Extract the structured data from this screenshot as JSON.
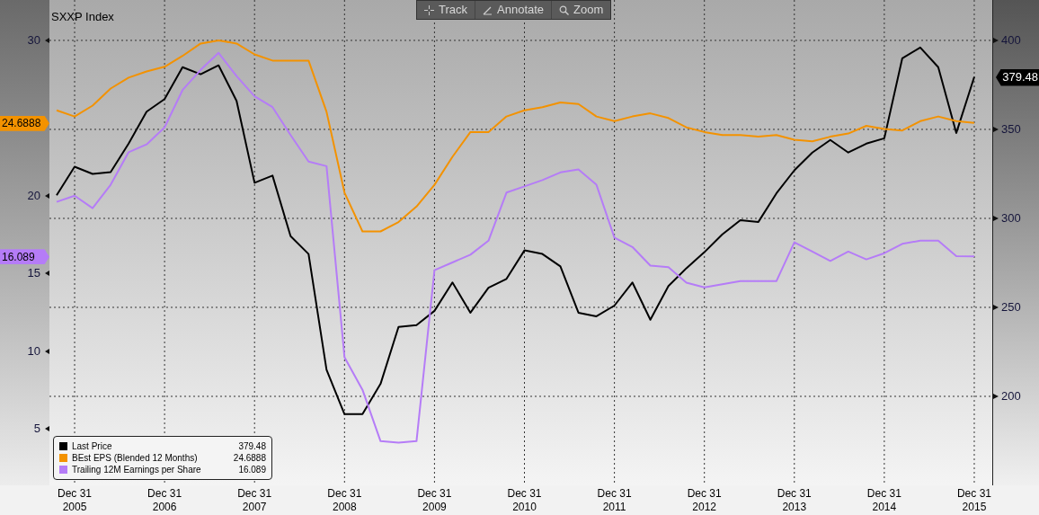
{
  "title": "SXXP Index",
  "toolbar": [
    {
      "label": "Track",
      "kind": "track"
    },
    {
      "label": "Annotate",
      "kind": "annotate"
    },
    {
      "label": "Zoom",
      "kind": "zoom"
    }
  ],
  "legend": [
    {
      "value": "379.48",
      "tag": "379.48"
    },
    {
      "value": "24.6888",
      "tag": "24.6888"
    },
    {
      "value": "16.089",
      "tag": "16.089"
    }
  ],
  "chart_data": {
    "type": "line",
    "categories": [
      null,
      "Dec 31 2005",
      null,
      null,
      null,
      null,
      "Dec 31 2006",
      null,
      null,
      null,
      null,
      "Dec 31 2007",
      null,
      null,
      null,
      null,
      "Dec 31 2008",
      null,
      null,
      null,
      null,
      "Dec 31 2009",
      null,
      null,
      null,
      null,
      "Dec 31 2010",
      null,
      null,
      null,
      null,
      "Dec 31 2011",
      null,
      null,
      null,
      null,
      "Dec 31 2012",
      null,
      null,
      null,
      null,
      "Dec 31 2013",
      null,
      null,
      null,
      null,
      "Dec 31 2014",
      null,
      null,
      null,
      null,
      "Dec 31 2015"
    ],
    "series": [
      {
        "name": "Last Price",
        "color": "#000000",
        "axis": "y2",
        "values": [
          313,
          329,
          325,
          326,
          342,
          360,
          367,
          385,
          381,
          386,
          366,
          320,
          324,
          290,
          280,
          215,
          190,
          190,
          207,
          239,
          240,
          248,
          264,
          247,
          261,
          266,
          282,
          280,
          273,
          247,
          245,
          251,
          264,
          243,
          262,
          272,
          281,
          291,
          299,
          298,
          314,
          327,
          337,
          344,
          337,
          342,
          345,
          390,
          396,
          385,
          348,
          379.5
        ]
      },
      {
        "name": "BEst EPS (Blended 12 Months)",
        "color": "#f39200",
        "values": [
          25.5,
          25.1,
          25.8,
          26.9,
          27.6,
          28.0,
          28.3,
          29.0,
          29.8,
          30.0,
          29.8,
          29.1,
          28.7,
          28.7,
          28.7,
          25.4,
          20.2,
          17.7,
          17.7,
          18.3,
          19.3,
          20.7,
          22.5,
          24.1,
          24.1,
          25.1,
          25.5,
          25.7,
          26.0,
          25.9,
          25.1,
          24.8,
          25.1,
          25.3,
          25.0,
          24.4,
          24.1,
          23.9,
          23.9,
          23.8,
          23.9,
          23.6,
          23.5,
          23.8,
          24.0,
          24.5,
          24.3,
          24.2,
          24.8,
          25.1,
          24.8,
          24.69
        ]
      },
      {
        "name": "Trailing 12M Earnings per Share",
        "color": "#b57cf7",
        "values": [
          19.6,
          20.0,
          19.2,
          20.7,
          22.8,
          23.3,
          24.4,
          26.8,
          28.1,
          29.2,
          27.7,
          26.4,
          25.7,
          23.9,
          22.2,
          21.9,
          9.6,
          7.5,
          4.2,
          4.1,
          4.2,
          15.2,
          15.7,
          16.2,
          17.1,
          20.2,
          20.6,
          21.0,
          21.5,
          21.7,
          20.7,
          17.3,
          16.7,
          15.5,
          15.4,
          14.4,
          14.1,
          14.3,
          14.5,
          14.5,
          14.5,
          17.0,
          16.4,
          15.8,
          16.4,
          15.9,
          16.3,
          16.9,
          17.1,
          17.1,
          16.1,
          16.09
        ]
      }
    ],
    "ylim": [
      1.35,
      32.6
    ],
    "yticks": [
      5,
      10,
      15,
      20,
      30
    ],
    "y2lim": [
      150,
      422.7
    ],
    "y2ticks": [
      200,
      250,
      300,
      350,
      400
    ],
    "grid": true,
    "legend": "lower left"
  }
}
